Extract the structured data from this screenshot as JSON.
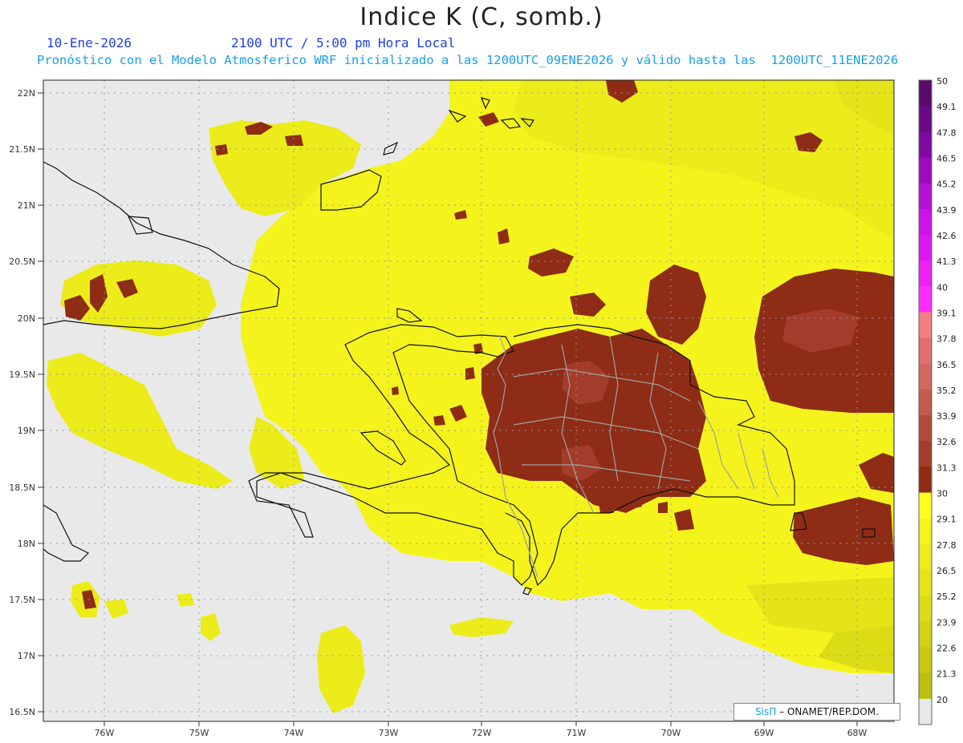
{
  "header": {
    "title": "Indice K (C, somb.)",
    "date": "10-Ene-2026",
    "time": "2100 UTC / 5:00 pm Hora Local",
    "description": "Pronóstico con el Modelo Atmosferico WRF inicializado a las 1200UTC_09ENE2026 y válido hasta las  1200UTC_11ENE2026"
  },
  "map": {
    "lat_labels": [
      "22N",
      "21.5N",
      "21N",
      "20.5N",
      "20N",
      "19.5N",
      "19N",
      "18.5N",
      "18N",
      "17.5N",
      "17N",
      "16.5N"
    ],
    "lon_labels": [
      "76W",
      "75W",
      "74W",
      "73W",
      "72W",
      "71W",
      "70W",
      "69W",
      "68W"
    ],
    "lat_range": [
      16.5,
      22
    ],
    "lon_range": [
      -76,
      -68
    ],
    "background_color": "#e9e9e9"
  },
  "colorbar": {
    "labels": [
      "50",
      "49.1",
      "47.8",
      "46.5",
      "45.2",
      "43.9",
      "42.6",
      "41.3",
      "40",
      "39.1",
      "37.8",
      "36.5",
      "35.2",
      "33.9",
      "32.6",
      "31.3",
      "30",
      "29.1",
      "27.8",
      "26.5",
      "25.2",
      "23.9",
      "22.6",
      "21.3",
      "20"
    ],
    "colors": [
      "#5a0a6a",
      "#6a0a84",
      "#7e0aa0",
      "#9a0cbc",
      "#b410d4",
      "#cc14e8",
      "#dc18f0",
      "#ee20f4",
      "#ff2cff",
      "#f08080",
      "#e07070",
      "#d4675f",
      "#c65a4e",
      "#b54a3c",
      "#a33c2a",
      "#8e2c16",
      "#ffff20",
      "#f4f41c",
      "#ecec1a",
      "#e4e418",
      "#dcdc16",
      "#d2d214",
      "#c8c812",
      "#bebe10",
      "#e8e8e8"
    ]
  },
  "credit": {
    "brand": "SisΠ",
    "text": "– ONAMET/REP.DOM."
  }
}
